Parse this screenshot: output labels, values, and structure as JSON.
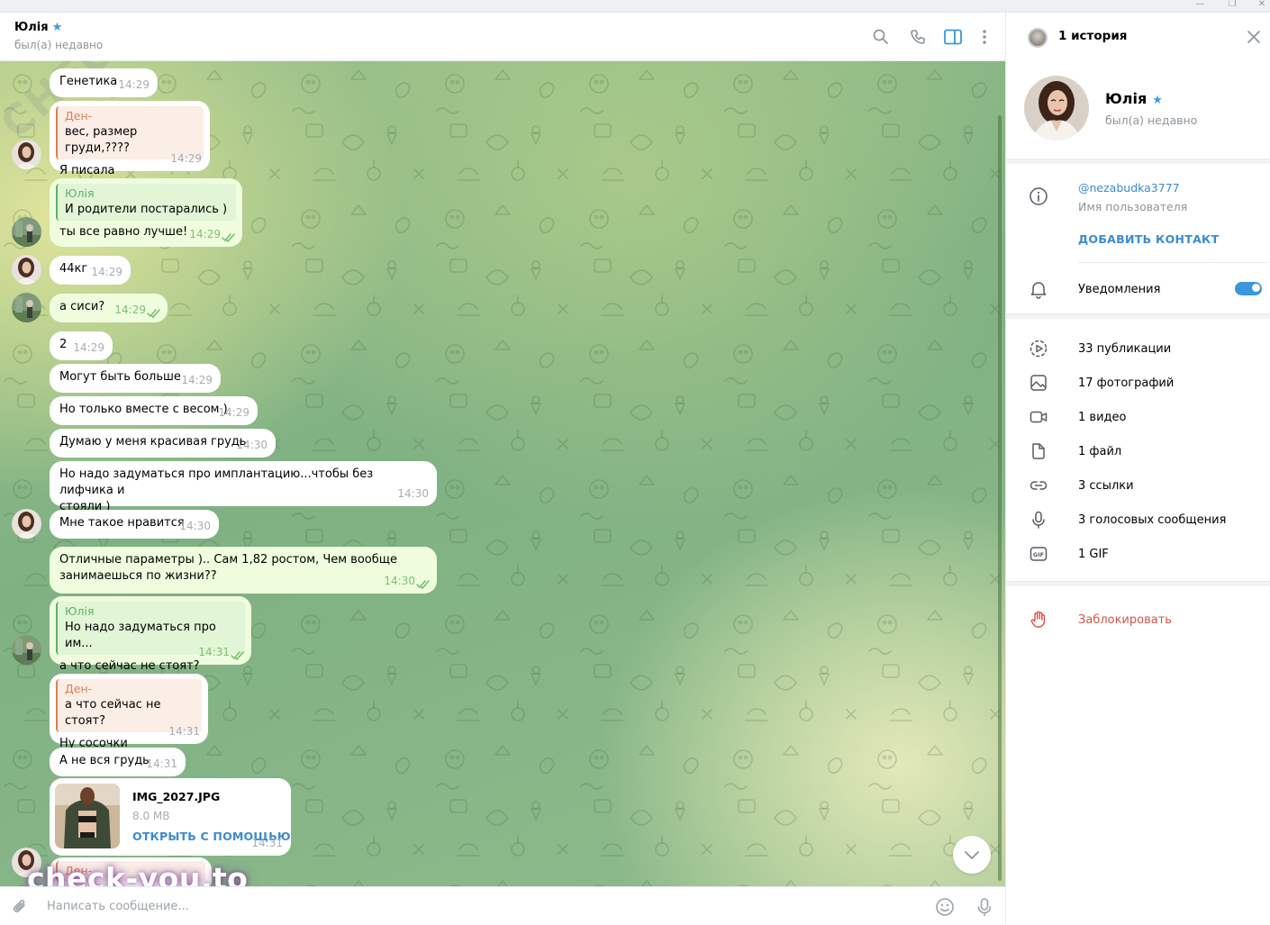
{
  "header": {
    "name": "Юлія",
    "verified_icon": "star-icon",
    "status": "был(а) недавно",
    "icons": [
      "search-icon",
      "phone-icon",
      "sidebar-toggle-icon",
      "more-vertical-icon"
    ]
  },
  "messages": [
    {
      "dir": "in",
      "text": "Генетика",
      "time": "14:29"
    },
    {
      "dir": "in",
      "reply_name": "Ден-",
      "reply_text": "вес, размер груди,????",
      "text": "Я писала",
      "time": "14:29"
    },
    {
      "dir": "out",
      "reply_name": "Юлія",
      "reply_text": "И родители постарались )",
      "text": "ты все равно лучше!",
      "time": "14:29"
    },
    {
      "dir": "in",
      "text": "44кг",
      "time": "14:29"
    },
    {
      "dir": "out",
      "text": "а сиси?",
      "time": "14:29"
    },
    {
      "dir": "in",
      "text": "2",
      "time": "14:29"
    },
    {
      "dir": "in",
      "text": "Могут быть больше",
      "time": "14:29"
    },
    {
      "dir": "in",
      "text": "Но только вместе с весом )",
      "time": "14:29"
    },
    {
      "dir": "in",
      "text": "Думаю у меня красивая грудь",
      "time": "14:30"
    },
    {
      "dir": "in",
      "text_line1": "Но надо задуматься про имплантацию...чтобы без лифчика и",
      "text_line2": "стояли )",
      "time": "14:30"
    },
    {
      "dir": "in",
      "text": "Мне такое нравится",
      "time": "14:30"
    },
    {
      "dir": "out",
      "text_line1": "Отличные параметры ).. Сам 1,82 ростом, Чем вообще",
      "text_line2": "занимаешься по жизни??",
      "time": "14:30"
    },
    {
      "dir": "out",
      "reply_name": "Юлія",
      "reply_text": "Но надо задуматься про им...",
      "text": "а что сейчас не стоят?",
      "time": "14:31"
    },
    {
      "dir": "in",
      "reply_name": "Ден-",
      "reply_text": "а что сейчас не стоят?",
      "text": "Ну сосочки",
      "time": "14:31"
    },
    {
      "dir": "in",
      "text": "А не вся грудь",
      "time": "14:31"
    },
    {
      "dir": "in",
      "file_name": "IMG_2027.JPG",
      "file_size": "8.0 MB",
      "file_action": "ОТКРЫТЬ С ПОМОЩЬЮ",
      "time": "14:31"
    },
    {
      "dir": "in",
      "reply_name": "Ден-"
    }
  ],
  "watermark": "check-you.to",
  "watermark_diag": "CHECK-YOU.ME",
  "composer": {
    "placeholder": "Написать сообщение...",
    "icons": [
      "attach-icon",
      "emoji-icon",
      "microphone-icon"
    ]
  },
  "panel": {
    "story_title": "1 история",
    "name": "Юлія",
    "status": "был(а) недавно",
    "username": "@nezabudka3777",
    "username_label": "Имя пользователя",
    "add_contact": "ДОБАВИТЬ КОНТАКТ",
    "notifications": "Уведомления",
    "notifications_on": true,
    "media": [
      {
        "icon": "publications-icon",
        "label": "33 публикации"
      },
      {
        "icon": "photo-icon",
        "label": "17 фотографий"
      },
      {
        "icon": "video-icon",
        "label": "1 видео"
      },
      {
        "icon": "file-icon",
        "label": "1 файл"
      },
      {
        "icon": "link-icon",
        "label": "3 ссылки"
      },
      {
        "icon": "microphone-icon",
        "label": "3 голосовых сообщения"
      },
      {
        "icon": "gif-icon",
        "label": "1 GIF"
      }
    ],
    "block": "Заблокировать"
  },
  "colors": {
    "accent": "#3a8bd0",
    "outgoing_bubble": "#effdde",
    "reply_orange": "#e07e4e",
    "reply_green": "#5bb36a",
    "danger": "#d2554a"
  }
}
